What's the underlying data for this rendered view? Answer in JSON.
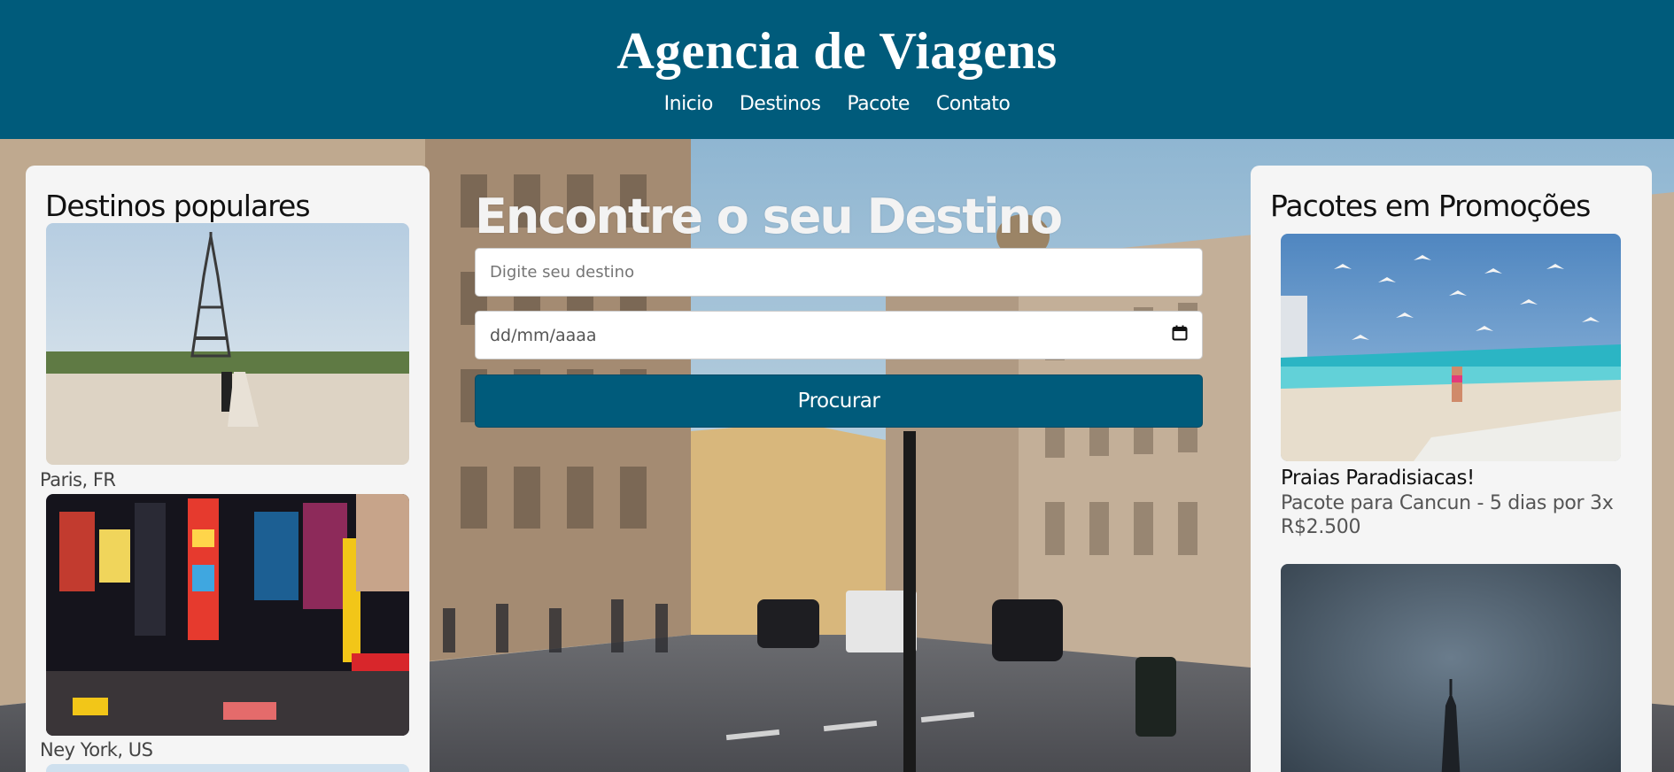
{
  "header": {
    "title": "Agencia de Viagens",
    "nav": [
      "Inicio",
      "Destinos",
      "Pacote",
      "Contato"
    ]
  },
  "popular": {
    "title": "Destinos populares",
    "items": [
      {
        "caption": "Paris, FR",
        "image": "eiffel-tower-photo"
      },
      {
        "caption": "Ney York, US",
        "image": "times-square-photo"
      }
    ]
  },
  "search": {
    "title": "Encontre o seu Destino",
    "destination_placeholder": "Digite seu destino",
    "date_placeholder": "dd/mm/aaaa",
    "button": "Procurar",
    "calendar_icon": "calendar-icon"
  },
  "promotions": {
    "title": "Pacotes em Promoções",
    "items": [
      {
        "title": "Praias Paradisiacas!",
        "description": "Pacote para Cancun - 5 dias por 3x R$2.500",
        "image": "beach-seagulls-photo"
      },
      {
        "title": "",
        "description": "",
        "image": "cloudy-tower-photo"
      }
    ]
  },
  "colors": {
    "header": "#005b7b",
    "button": "#005b7b",
    "panel": "#f5f5f5"
  }
}
